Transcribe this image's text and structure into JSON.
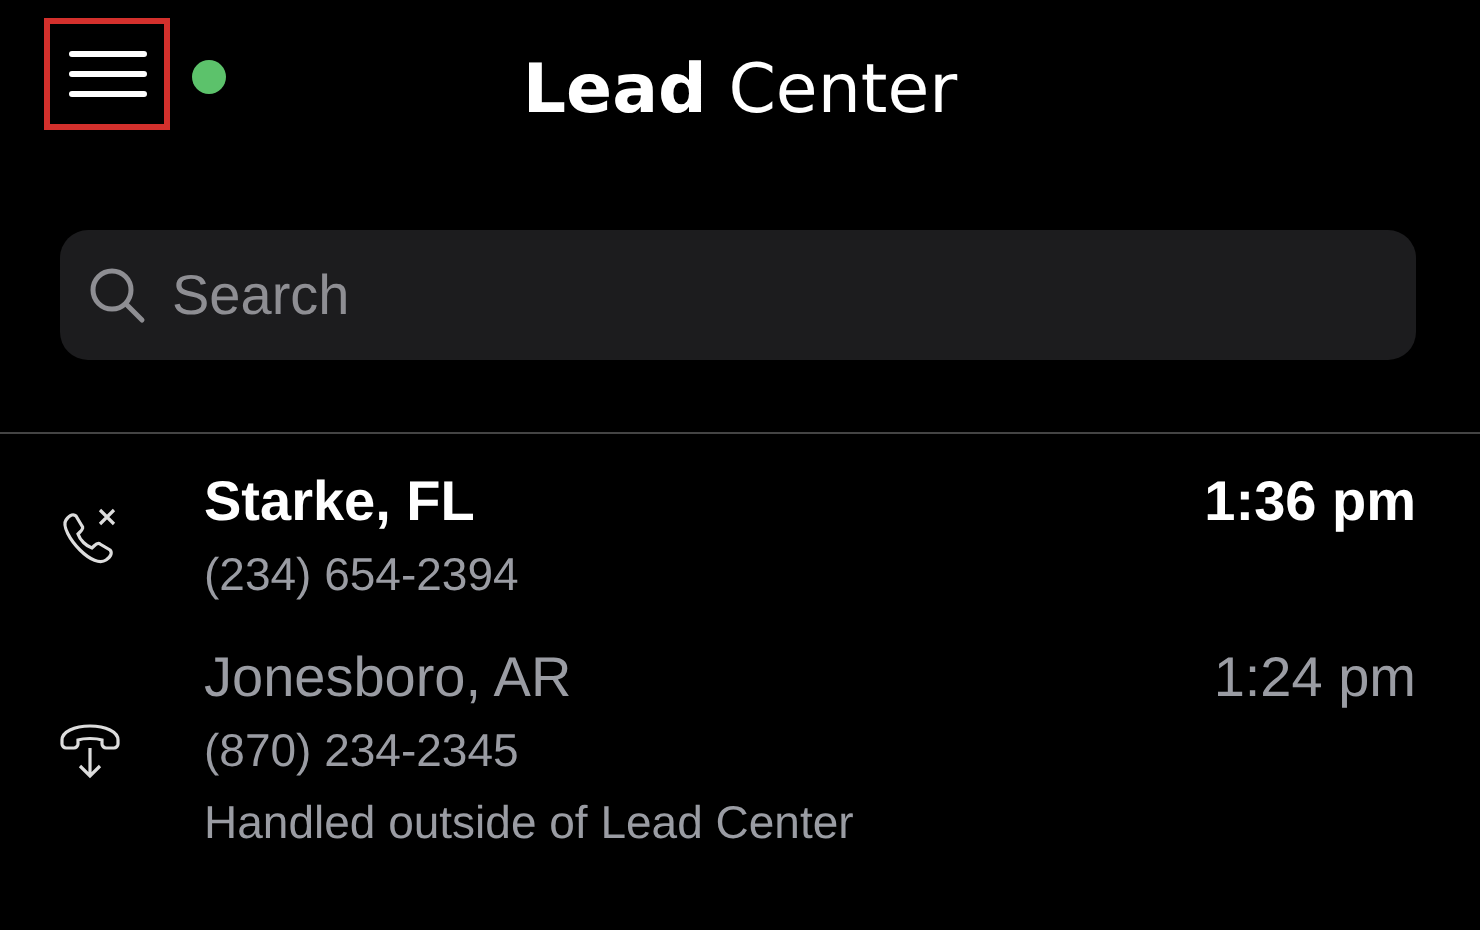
{
  "header": {
    "menu_button": {
      "highlighted": true
    },
    "status": {
      "color": "#5cc26b"
    },
    "title": "**Lead** Center"
  },
  "search": {
    "placeholder": "Search"
  },
  "calls": [
    {
      "kind": "missed",
      "unread": true,
      "location": "Starke, FL",
      "phone": "(234) 654-2394",
      "time": "1:36 pm"
    },
    {
      "kind": "handled",
      "unread": false,
      "location": "Jonesboro, AR",
      "phone": "(870) 234-2345",
      "note": "Handled outside of Lead Center",
      "time": "1:24 pm"
    }
  ]
}
